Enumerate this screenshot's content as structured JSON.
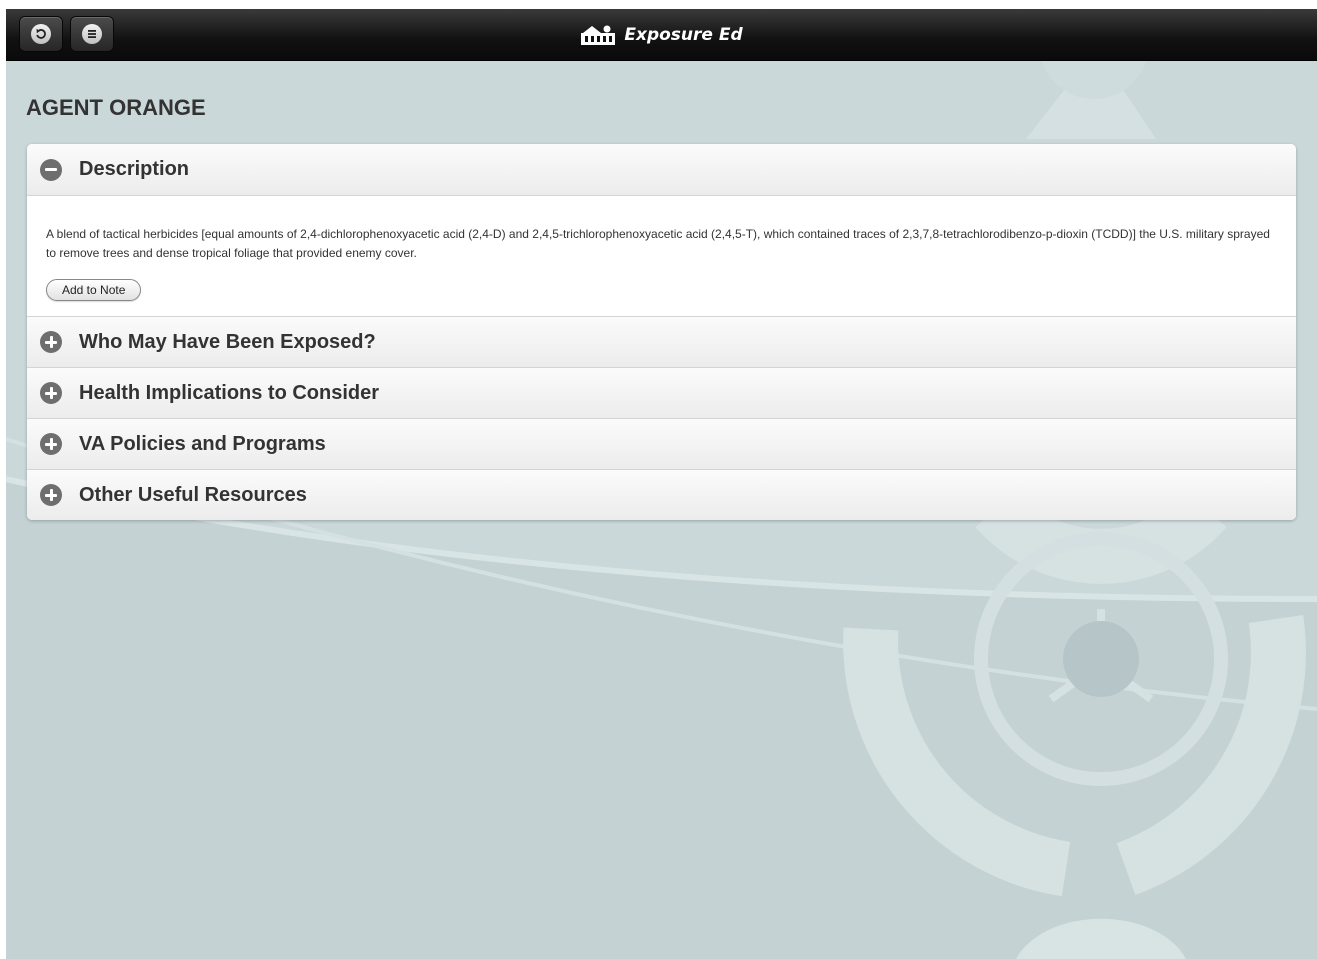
{
  "app": {
    "title": "Exposure Ed"
  },
  "toolbar": {
    "back_icon": "back-arrow-icon",
    "menu_icon": "menu-list-icon"
  },
  "page": {
    "title": "AGENT ORANGE"
  },
  "sections": [
    {
      "label": "Description",
      "expanded": true,
      "body": "A blend of tactical herbicides [equal amounts of 2,4-dichlorophenoxyacetic acid (2,4-D) and 2,4,5-trichlorophenoxyacetic acid (2,4,5-T), which contained traces of 2,3,7,8-tetrachlorodibenzo-p-dioxin (TCDD)] the U.S. military sprayed to remove trees and dense tropical foliage that provided enemy cover.",
      "button_label": "Add to Note"
    },
    {
      "label": "Who May Have Been Exposed?",
      "expanded": false
    },
    {
      "label": "Health Implications to Consider",
      "expanded": false
    },
    {
      "label": "VA Policies and Programs",
      "expanded": false
    },
    {
      "label": "Other Useful Resources",
      "expanded": false
    }
  ],
  "colors": {
    "background": "#cad8da",
    "topbar": "#111111",
    "text": "#333333"
  }
}
